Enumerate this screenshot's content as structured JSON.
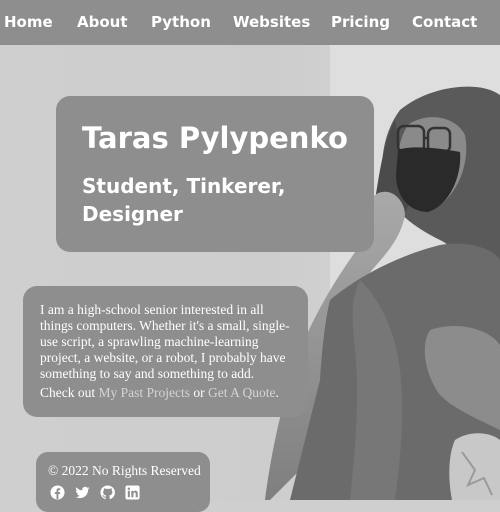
{
  "nav": {
    "items": [
      {
        "label": "Home"
      },
      {
        "label": "About"
      },
      {
        "label": "Python"
      },
      {
        "label": "Websites"
      },
      {
        "label": "Pricing"
      },
      {
        "label": "Contact"
      }
    ]
  },
  "hero": {
    "name": "Taras Pylypenko",
    "tagline": "Student, Tinkerer, Designer"
  },
  "about": {
    "text": "I am a high-school senior interested in all things computers. Whether it's a small, single-use script, a sprawling machine-learning project, a website, or a robot, I probably have something to say and something to add.",
    "cta_prefix": "Check out ",
    "cta_link1": "My Past Projects",
    "cta_or": " or ",
    "cta_link2": "Get A Quote",
    "cta_suffix": "."
  },
  "footer": {
    "copyright": "© 2022 No Rights Reserved",
    "social_icons": [
      "facebook-icon",
      "twitter-icon",
      "github-icon",
      "linkedin-icon"
    ]
  },
  "colors": {
    "nav_bg": "#8e8e8e",
    "card_bg": "#8e8e8e",
    "page_bg": "#cfcfcf",
    "link": "#d4d4d4"
  }
}
